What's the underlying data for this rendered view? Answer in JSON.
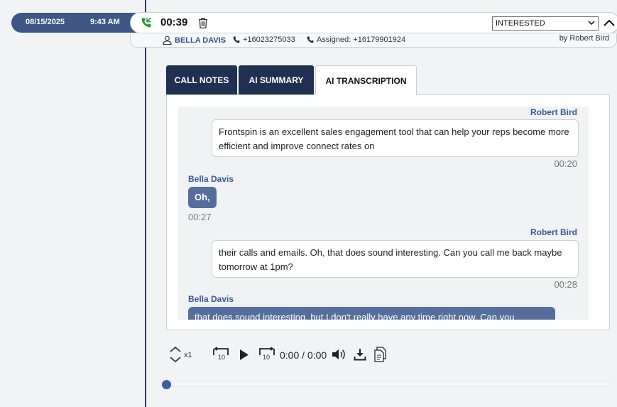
{
  "call": {
    "date": "08/15/2025",
    "time": "9:43 AM",
    "duration": "00:39",
    "status": "INTERESTED",
    "contact_name": "BELLA DAVIS",
    "phone": "+16023275033",
    "assigned": "Assigned: +16179901924",
    "by_user": "by Robert Bird"
  },
  "tabs": [
    {
      "label": "CALL NOTES",
      "active": false
    },
    {
      "label": "AI SUMMARY",
      "active": false
    },
    {
      "label": "AI TRANSCRIPTION",
      "active": true
    }
  ],
  "transcript": [
    {
      "speaker": "Robert Bird",
      "side": "agent",
      "text": "Frontspin is an excellent sales engagement tool that can help your reps become more efficient and improve connect rates on",
      "time": "00:20"
    },
    {
      "speaker": "Bella Davis",
      "side": "contact",
      "text": "Oh,",
      "time": "00:27"
    },
    {
      "speaker": "Robert Bird",
      "side": "agent",
      "text": "their calls and emails. Oh, that does sound interesting. Can you call me back maybe tomorrow at 1pm?",
      "time": "00:28"
    },
    {
      "speaker": "Bella Davis",
      "side": "contact",
      "text": "that does sound interesting, but I don't really have any time right now. Can you",
      "time": ""
    }
  ],
  "player": {
    "speed": "x1",
    "skip_back": "10",
    "skip_forward": "10",
    "current_time": "0:00",
    "total_time": "0:00",
    "time_display": "0:00 / 0:00",
    "progress": 0
  },
  "colors": {
    "navy": "#1f3150",
    "accent": "#3e5784",
    "bubble_contact": "#556e9c",
    "speaker_name": "#3a5a96",
    "call_icon": "#1a9a3a"
  },
  "icons": {
    "call": "phone-incoming-icon",
    "delete": "trash-icon",
    "collapse": "chevron-up-icon",
    "contact": "person-icon"
  }
}
